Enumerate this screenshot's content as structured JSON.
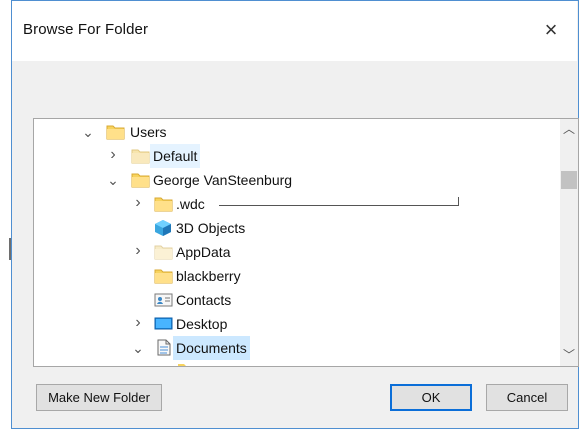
{
  "dialog": {
    "title": "Browse For Folder",
    "close_symbol": "×"
  },
  "tree": {
    "items": [
      {
        "label": "Users",
        "icon": "folder-icon",
        "expanded": true
      },
      {
        "label": "Default",
        "icon": "folder-icon",
        "expanded": false
      },
      {
        "label": "George VanSteenburg",
        "icon": "folder-icon",
        "expanded": true
      },
      {
        "label": ".wdc",
        "icon": "folder-icon",
        "expanded": false
      },
      {
        "label": "3D Objects",
        "icon": "3d-objects-icon",
        "expanded": false
      },
      {
        "label": "AppData",
        "icon": "folder-icon",
        "expanded": false
      },
      {
        "label": "blackberry",
        "icon": "folder-icon",
        "expanded": false
      },
      {
        "label": "Contacts",
        "icon": "contacts-icon",
        "expanded": false
      },
      {
        "label": "Desktop",
        "icon": "desktop-icon",
        "expanded": false
      },
      {
        "label": "Documents",
        "icon": "documents-icon",
        "expanded": true
      }
    ]
  },
  "buttons": {
    "make_new_folder": "Make New Folder",
    "ok": "OK",
    "cancel": "Cancel"
  },
  "colors": {
    "selection": "#cce8ff",
    "focus_border": "#0b6ed8",
    "window_border": "#4f8fd1"
  }
}
